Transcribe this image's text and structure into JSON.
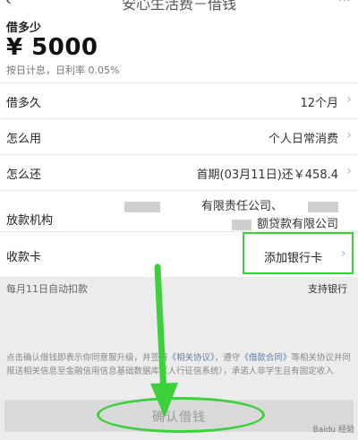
{
  "header": {
    "title": "安心生活费－借钱",
    "back_icon": "back-arrow-icon",
    "more_icon": "more-icon"
  },
  "amount": {
    "label": "借多少",
    "value": "¥ 5000",
    "note": "按日计息，日利率 0.05%"
  },
  "rows": [
    {
      "label": "借多久",
      "value": "12个月"
    },
    {
      "label": "怎么用",
      "value": "个人日常消费"
    },
    {
      "label": "怎么还",
      "value": "首期(03月11日)还￥458.4"
    },
    {
      "label": "放款机构",
      "value_line1": "有限责任公司、",
      "value_line2": "额贷款有限公司"
    }
  ],
  "card": {
    "label": "收款卡",
    "action": "添加银行卡"
  },
  "autopay": {
    "text": "每月11日自动扣款",
    "support_link": "支持银行"
  },
  "agreement": {
    "prefix": "点击确认借钱即表示你同意服",
    "mid1": "升级，并签署",
    "link1": "《相关协议》",
    "mid2": "，遵守",
    "link2": "《借款合同》",
    "mid3": "等相关协议并同",
    "mid4": "报送相关信息至金融信用信息基础数据库（人行征信系统），承诺",
    "mid5": "人非学生且有固定收入"
  },
  "confirm_button": {
    "label": "确认借钱"
  },
  "watermark": "Baidu 经验",
  "colors": {
    "highlight": "#3ad13a",
    "link": "#5c7fae",
    "disabled_button": "#d9d9d9"
  }
}
